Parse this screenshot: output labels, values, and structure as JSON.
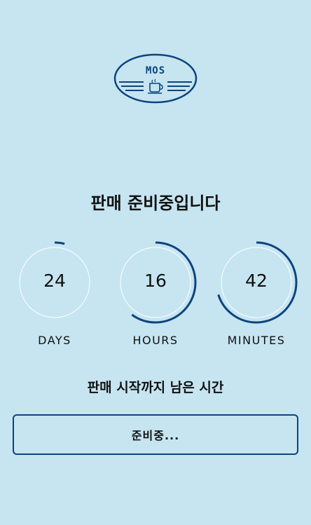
{
  "logo": {
    "text": "MOS",
    "icon": "coffee-cup-icon",
    "color": "#0d447d"
  },
  "title": "판매 준비중입니다",
  "countdown": [
    {
      "value": "24",
      "unit": "DAYS",
      "progress": 0.04
    },
    {
      "value": "16",
      "unit": "HOURS",
      "progress": 0.6
    },
    {
      "value": "42",
      "unit": "MINUTES",
      "progress": 0.7
    }
  ],
  "subtitle": "판매 시작까지 남은 시간",
  "status_button": {
    "label": "준비중..."
  },
  "colors": {
    "background": "#c6e5f1",
    "accent": "#0d447d",
    "track": "#ffffff"
  }
}
